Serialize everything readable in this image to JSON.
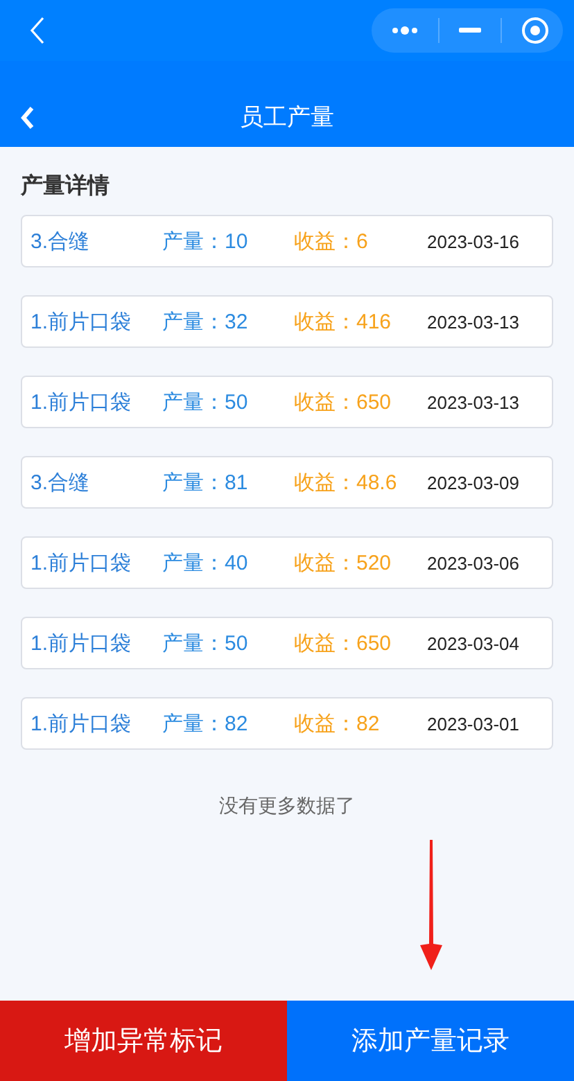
{
  "nav": {
    "title": "员工产量"
  },
  "section": {
    "title": "产量详情"
  },
  "records": [
    {
      "process": "3.合缝",
      "quantity": "产量：10",
      "earnings": "收益：6",
      "date": "2023-03-16"
    },
    {
      "process": "1.前片口袋",
      "quantity": "产量：32",
      "earnings": "收益：416",
      "date": "2023-03-13"
    },
    {
      "process": "1.前片口袋",
      "quantity": "产量：50",
      "earnings": "收益：650",
      "date": "2023-03-13"
    },
    {
      "process": "3.合缝",
      "quantity": "产量：81",
      "earnings": "收益：48.6",
      "date": "2023-03-09"
    },
    {
      "process": "1.前片口袋",
      "quantity": "产量：40",
      "earnings": "收益：520",
      "date": "2023-03-06"
    },
    {
      "process": "1.前片口袋",
      "quantity": "产量：50",
      "earnings": "收益：650",
      "date": "2023-03-04"
    },
    {
      "process": "1.前片口袋",
      "quantity": "产量：82",
      "earnings": "收益：82",
      "date": "2023-03-01"
    }
  ],
  "end_note": "没有更多数据了",
  "buttons": [
    {
      "label": "增加异常标记",
      "kind": "danger"
    },
    {
      "label": "添加产量记录",
      "kind": "primary"
    }
  ]
}
